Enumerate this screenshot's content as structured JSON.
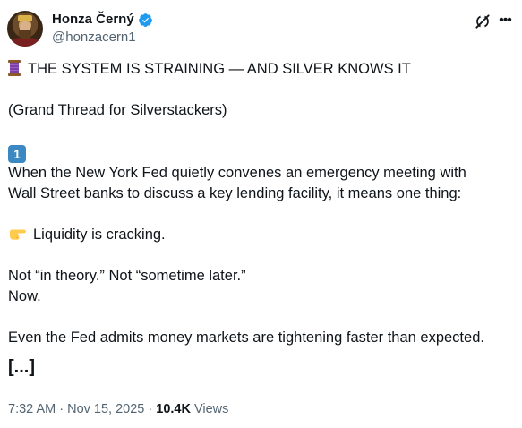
{
  "author": {
    "display_name": "Honza Černý",
    "handle": "@honzacern1",
    "verified": true,
    "avatar_icon": "avatar-king-portrait"
  },
  "header_icons": {
    "grok": "grok-icon",
    "more": "more-options-icon",
    "verified": "verified-badge-icon",
    "accent": "#1d9bf0"
  },
  "tweet": {
    "line1": "THE SYSTEM IS STRAINING — AND SILVER KNOWS IT",
    "line1_icon": "thread-spool-icon",
    "line2": "(Grand Thread for Silverstackers)",
    "keycap": "1",
    "keycap_icon": "keycap-one-icon",
    "para1": "When the New York Fed quietly convenes an emergency meeting with\nWall Street banks to discuss a key lending facility, it means one thing:",
    "para2": "Liquidity is cracking.",
    "para2_icon": "pointing-hand-icon",
    "para3": "Not “in theory.” Not “sometime later.”\nNow.",
    "para4": "Even the Fed admits money markets are tightening faster than expected.",
    "truncation": "[...]"
  },
  "meta": {
    "time": "7:32 AM",
    "sep1": " · ",
    "date": "Nov 15, 2025",
    "sep2": " · ",
    "views_count": "10.4K",
    "views_label": " Views"
  }
}
